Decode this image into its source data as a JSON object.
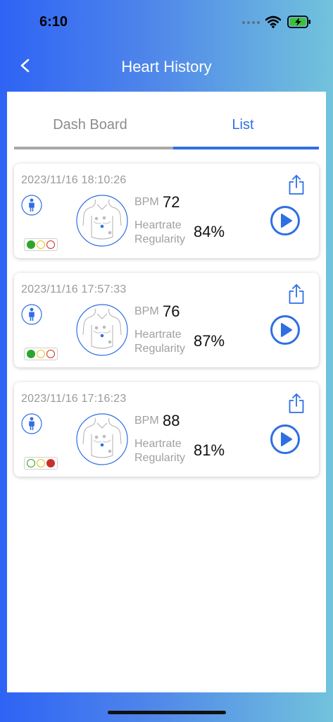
{
  "status_bar": {
    "time": "6:10"
  },
  "nav": {
    "title": "Heart History"
  },
  "tabs": [
    {
      "label": "Dash Board"
    },
    {
      "label": "List"
    }
  ],
  "labels": {
    "bpm": "BPM",
    "heartrate": "Heartrate",
    "regularity": "Regularity"
  },
  "colors": {
    "accent": "#2f6fe4",
    "light_green": "#2aa62a",
    "light_yellow": "#e8c21a",
    "light_red": "#c9302c"
  },
  "records": [
    {
      "timestamp": "2023/11/16 18:10:26",
      "bpm": "72",
      "regularity": "84%",
      "active_light": "green"
    },
    {
      "timestamp": "2023/11/16 17:57:33",
      "bpm": "76",
      "regularity": "87%",
      "active_light": "green"
    },
    {
      "timestamp": "2023/11/16 17:16:23",
      "bpm": "88",
      "regularity": "81%",
      "active_light": "red"
    }
  ]
}
